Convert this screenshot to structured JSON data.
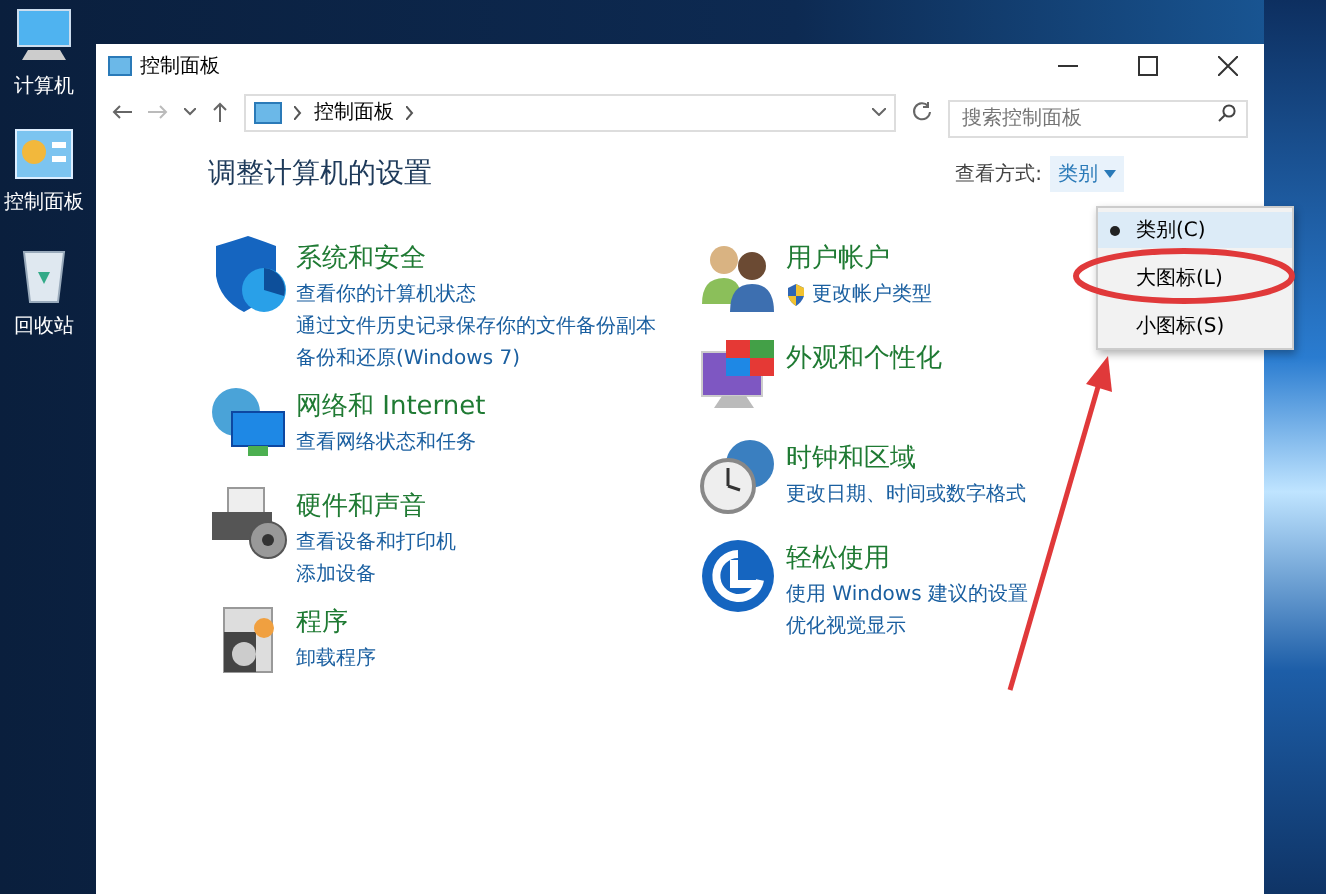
{
  "desktop_icons": [
    {
      "label": "计算机",
      "kind": "computer"
    },
    {
      "label": "控制面板",
      "kind": "panel"
    },
    {
      "label": "回收站",
      "kind": "bin"
    }
  ],
  "window": {
    "title": "控制面板",
    "breadcrumb": "控制面板",
    "search": {
      "placeholder": "搜索控制面板"
    },
    "heading": "调整计算机的设置",
    "view_by": {
      "label": "查看方式:",
      "value": "类别"
    }
  },
  "view_menu": [
    {
      "label": "类别(C)",
      "selected": true
    },
    {
      "label": "大图标(L)",
      "selected": false
    },
    {
      "label": "小图标(S)",
      "selected": false
    }
  ],
  "columns": [
    [
      {
        "kind": "security",
        "title": "系统和安全",
        "links": [
          {
            "text": "查看你的计算机状态",
            "shield": false
          },
          {
            "text": "通过文件历史记录保存你的文件备份副本",
            "shield": false
          },
          {
            "text": "备份和还原(Windows 7)",
            "shield": false
          }
        ]
      },
      {
        "kind": "network",
        "title": "网络和 Internet",
        "links": [
          {
            "text": "查看网络状态和任务",
            "shield": false
          }
        ]
      },
      {
        "kind": "hardware",
        "title": "硬件和声音",
        "links": [
          {
            "text": "查看设备和打印机",
            "shield": false
          },
          {
            "text": "添加设备",
            "shield": false
          }
        ]
      },
      {
        "kind": "programs",
        "title": "程序",
        "links": [
          {
            "text": "卸载程序",
            "shield": false
          }
        ]
      }
    ],
    [
      {
        "kind": "accounts",
        "title": "用户帐户",
        "links": [
          {
            "text": "更改帐户类型",
            "shield": true
          }
        ]
      },
      {
        "kind": "appearance",
        "title": "外观和个性化"
      },
      {
        "kind": "clock",
        "title": "时钟和区域",
        "links": [
          {
            "text": "更改日期、时间或数字格式",
            "shield": false
          }
        ]
      },
      {
        "kind": "ease",
        "title": "轻松使用",
        "links": [
          {
            "text": "使用 Windows 建议的设置",
            "shield": false
          },
          {
            "text": "优化视觉显示",
            "shield": false
          }
        ]
      }
    ]
  ]
}
